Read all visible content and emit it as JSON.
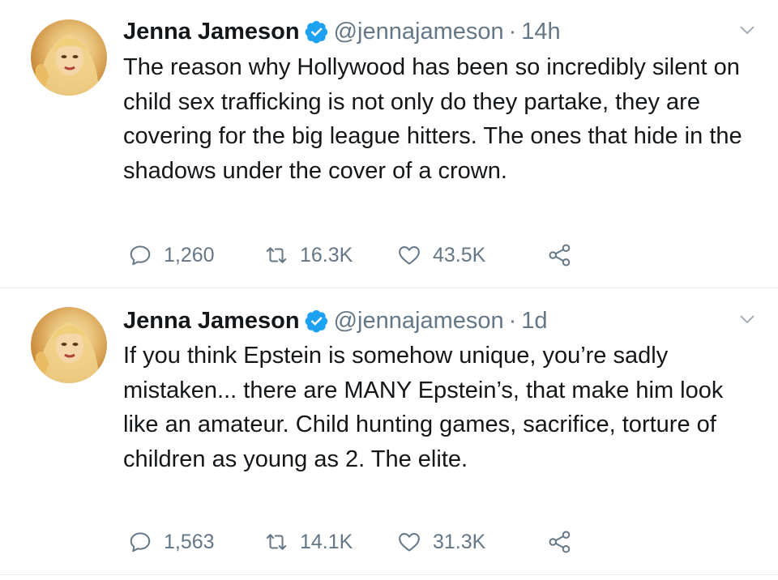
{
  "tweets": [
    {
      "author_name": "Jenna Jameson",
      "handle": "@jennajameson",
      "separator": "·",
      "time": "14h",
      "text": "The reason why Hollywood has been so incredibly silent on child sex trafficking is not only do they partake, they are covering for the big league hitters. The ones that hide in the shadows under the cover of a crown.",
      "replies": "1,260",
      "retweets": "16.3K",
      "likes": "43.5K"
    },
    {
      "author_name": "Jenna Jameson",
      "handle": "@jennajameson",
      "separator": "·",
      "time": "1d",
      "text": "If you think Epstein is somehow unique, you’re sadly mistaken... there are MANY Epstein’s, that make him look like an amateur. Child hunting games, sacrifice, torture of children as young as 2. The elite.",
      "replies": "1,563",
      "retweets": "14.1K",
      "likes": "31.3K"
    }
  ],
  "colors": {
    "text": "#14171a",
    "secondary": "#657786",
    "verified": "#1da1f2",
    "divider": "#e6ecf0"
  },
  "icons": {
    "verified": "verified-badge-icon",
    "caret": "chevron-down-icon",
    "reply": "reply-icon",
    "retweet": "retweet-icon",
    "like": "heart-icon",
    "share": "share-icon"
  }
}
